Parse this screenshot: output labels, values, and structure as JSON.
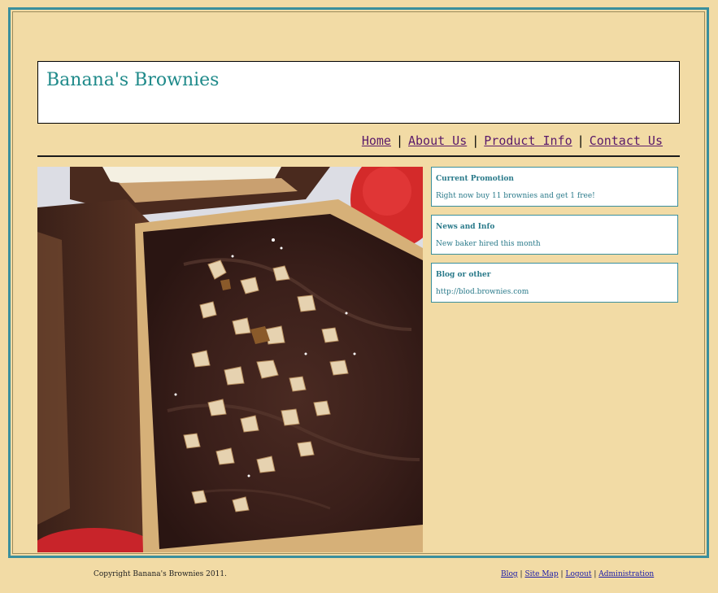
{
  "site": {
    "title": "Banana's Brownies"
  },
  "nav": {
    "items": [
      {
        "label": "Home"
      },
      {
        "label": "About Us"
      },
      {
        "label": "Product Info"
      },
      {
        "label": "Contact Us"
      }
    ],
    "separator": "|"
  },
  "hero": {
    "image_name": "brownie-photo"
  },
  "sidebar": {
    "boxes": [
      {
        "title": "Current Promotion",
        "text": "Right now buy 11 brownies and get 1 free!"
      },
      {
        "title": "News and Info",
        "text": "New baker hired this month"
      },
      {
        "title": "Blog or other",
        "text": "http://blod.brownies.com"
      }
    ]
  },
  "footer": {
    "copyright": "Copyright Banana's Brownies 2011.",
    "links": [
      {
        "label": "Blog"
      },
      {
        "label": "Site Map"
      },
      {
        "label": "Logout"
      },
      {
        "label": "Administration"
      }
    ],
    "separator": "|"
  },
  "colors": {
    "page_background": "#f2dba5",
    "frame_border": "#3a8f9d",
    "title_text": "#1f8a8a",
    "nav_link": "#5a1a6a",
    "sidebar_text": "#2a7a8a",
    "footer_link": "#1a1aaa"
  }
}
